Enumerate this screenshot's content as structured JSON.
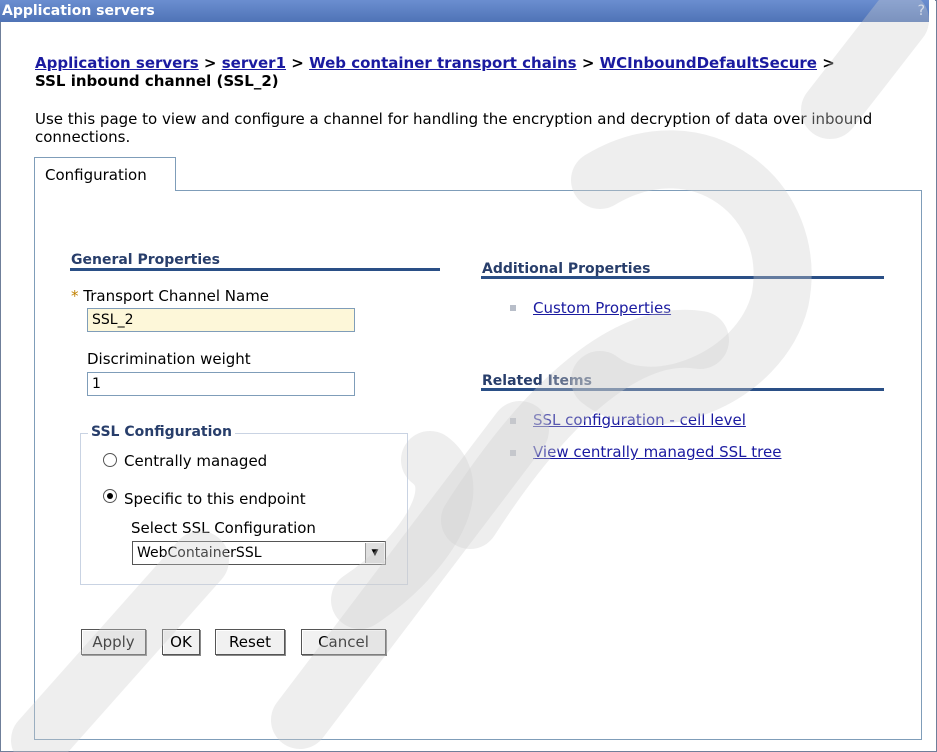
{
  "window": {
    "title": "Application servers",
    "help": "?"
  },
  "breadcrumb": {
    "links": [
      "Application servers",
      "server1",
      "Web container transport chains",
      "WCInboundDefaultSecure"
    ],
    "separator": ">",
    "current": "SSL inbound channel (SSL_2)"
  },
  "description": "Use this page to view and configure a channel for handling the encryption and decryption of data over inbound connections.",
  "tabs": [
    {
      "label": "Configuration"
    }
  ],
  "general": {
    "title": "General Properties",
    "required_mark": "*",
    "channel_name_label": "Transport Channel Name",
    "channel_name_value": "SSL_2",
    "weight_label": "Discrimination weight",
    "weight_value": "1"
  },
  "ssl_config": {
    "title": "SSL Configuration",
    "option_central": "Centrally managed",
    "option_specific": "Specific to this endpoint",
    "selected": "specific",
    "select_label": "Select SSL Configuration",
    "select_value": "WebContainerSSL"
  },
  "buttons": {
    "apply": "Apply",
    "ok": "OK",
    "reset": "Reset",
    "cancel": "Cancel"
  },
  "additional": {
    "title": "Additional Properties",
    "links": [
      "Custom Properties"
    ]
  },
  "related": {
    "title": "Related Items",
    "links": [
      "SSL configuration - cell level",
      "View centrally managed SSL tree"
    ]
  },
  "colors": {
    "title_bar": "#5a7fc0",
    "link": "#1a1aa0",
    "section_rule": "#2a4f86",
    "required_field": "#fdf7d9"
  }
}
